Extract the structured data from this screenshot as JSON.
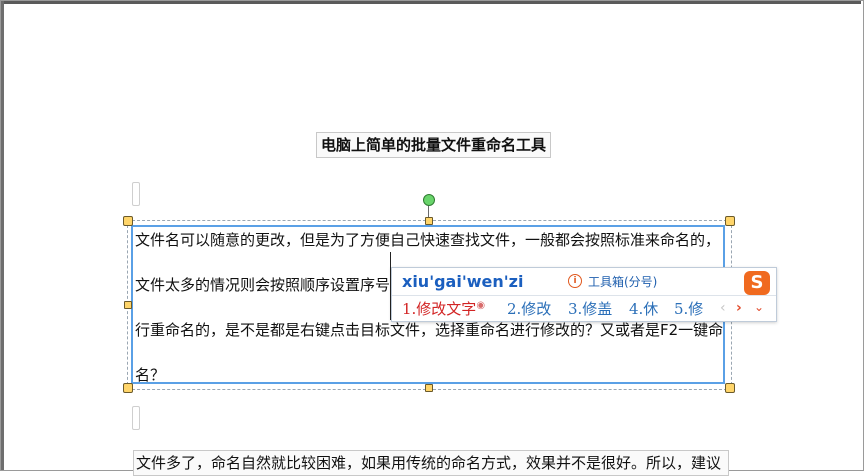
{
  "document": {
    "title": "电脑上简单的批量文件重命名工具",
    "textbox_lines": [
      "文件名可以随意的更改，但是为了方便自己快速查找文件，一般都会按照标准来命名的，",
      "文件太多的情况则会按照顺序设置序号",
      "行重命名的，是不是都是右键点击目标文件，选择重命名进行修改的？又或者是F2一键命",
      "名？"
    ],
    "next_paragraph": "文件多了，命名自然就比较困难，如果用传统的命名方式，效果并不是很好。所以，建议"
  },
  "ime": {
    "pinyin": "xiu'gai'wen'zi",
    "toolbox_label": "工具箱(分号)",
    "toolbox_icon": "info-circle-icon",
    "logo_char": "S",
    "candidates": [
      {
        "label": "1.修改文字"
      },
      {
        "label": "2.修改"
      },
      {
        "label": "3.修盖"
      },
      {
        "label": "4.休"
      },
      {
        "label": "5.修"
      }
    ],
    "nav_prev": "‹",
    "nav_next": "›",
    "nav_more": "⌄",
    "colors": {
      "selected_candidate": "#d22424",
      "candidate": "#2b6fb8",
      "brand": "#f06a1f"
    }
  }
}
